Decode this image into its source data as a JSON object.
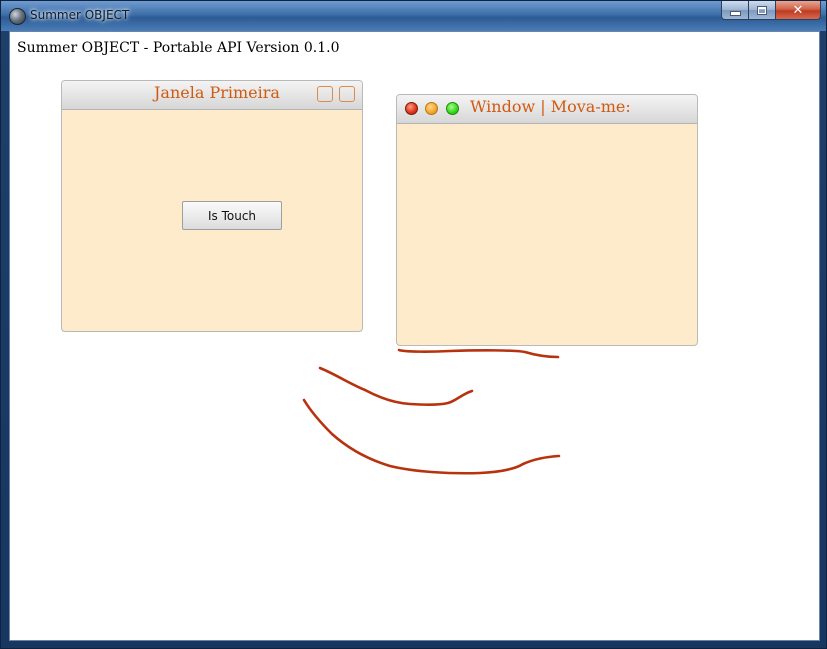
{
  "window": {
    "title": "Summer OBJECT",
    "controls": {
      "minimize": "",
      "maximize": "",
      "close": "✕"
    }
  },
  "app": {
    "header": "Summer OBJECT - Portable API Version 0.1.0"
  },
  "panel_primary": {
    "title": "Janela Primeira",
    "button_label": "Is Touch"
  },
  "panel_window": {
    "title": "Window | Mova-me:"
  },
  "colors": {
    "panel_bg": "#fdebcb",
    "panel_title": "#d05a12",
    "stroke": "#b8320e"
  }
}
